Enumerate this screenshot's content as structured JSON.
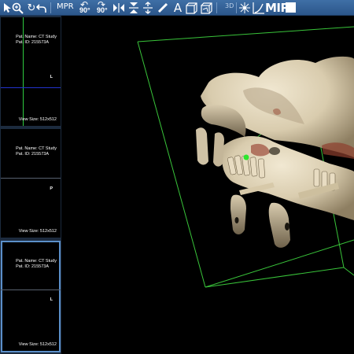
{
  "toolbar": {
    "mpr_label": "MPR",
    "rotate_ccw_label": "90°",
    "rotate_cw_label": "90°",
    "a_label": "A",
    "three_d_label": "3D",
    "mip_label": "MIP",
    "icons": [
      "cursor-icon",
      "zoom-icon",
      "refresh-icon",
      "undo-icon",
      "rotate-ccw-icon",
      "rotate-cw-icon",
      "flip-horizontal-icon",
      "flip-vertical-icon",
      "measure-icon",
      "text-annotation-icon",
      "volume-icon",
      "light-icon",
      "curve-icon",
      "mip-icon",
      "box-icon"
    ]
  },
  "viewports": [
    {
      "patient_name": "Pat. Name: CT Study",
      "patient_id": "Pat. ID: 215573A",
      "orientation": "L",
      "view_size": "View Size: 512x512"
    },
    {
      "patient_name": "Pat. Name: CT Study",
      "patient_id": "Pat. ID: 215573A",
      "orientation": "P",
      "view_size": "View Size: 512x512"
    },
    {
      "patient_name": "Pat. Name: CT Study",
      "patient_id": "Pat. ID: 215573A",
      "orientation": "L",
      "view_size": "View Size: 512x512"
    }
  ],
  "colors": {
    "toolbar_bg": "#3a6aa2",
    "crosshair_vertical": "#2ecc40",
    "crosshair_horizontal": "#2233cc",
    "bounding_box": "#39c43a",
    "bone": "#e3d7bd",
    "selected_border": "#5b8fc9"
  }
}
